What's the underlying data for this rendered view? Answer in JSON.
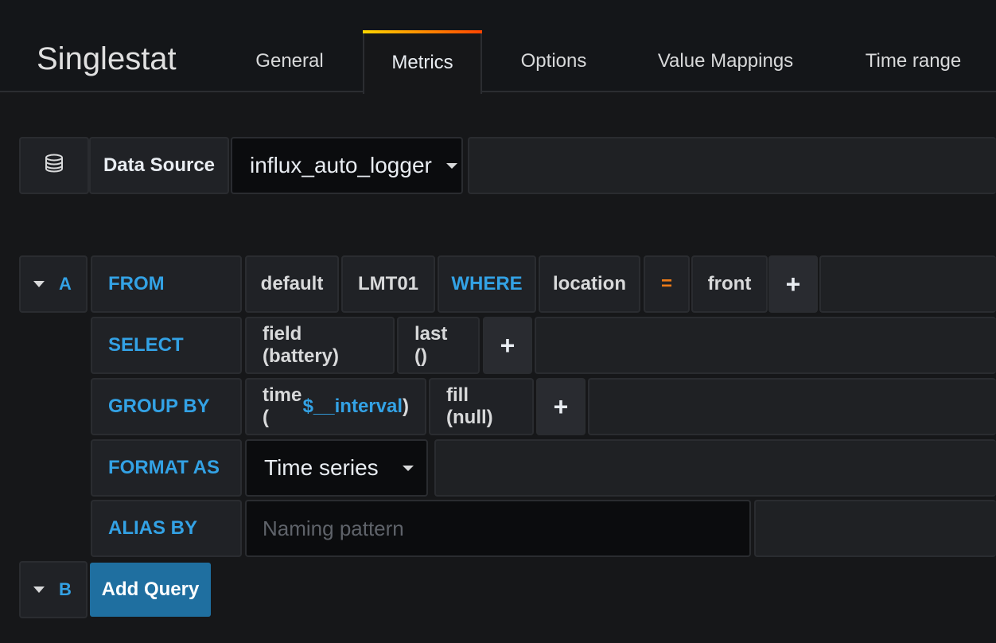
{
  "panel": {
    "title": "Singlestat"
  },
  "tabs": [
    {
      "label": "General"
    },
    {
      "label": "Metrics"
    },
    {
      "label": "Options"
    },
    {
      "label": "Value Mappings"
    },
    {
      "label": "Time range"
    }
  ],
  "active_tab": "Metrics",
  "datasource": {
    "label": "Data Source",
    "value": "influx_auto_logger",
    "icon": "database-icon"
  },
  "query_a": {
    "letter": "A",
    "from": {
      "label": "FROM",
      "retention_policy": "default",
      "measurement": "LMT01",
      "where_keyword": "WHERE",
      "tag_key": "location",
      "operator": "=",
      "tag_value": "front",
      "add": "+"
    },
    "select": {
      "label": "SELECT",
      "field": "field (battery)",
      "func": "last ()",
      "add": "+"
    },
    "group_by": {
      "label": "GROUP BY",
      "time_prefix": "time (",
      "time_var": "$__interval",
      "time_suffix": ")",
      "fill": "fill (null)",
      "add": "+"
    },
    "format_as": {
      "label": "FORMAT AS",
      "value": "Time series"
    },
    "alias_by": {
      "label": "ALIAS BY",
      "placeholder": "Naming pattern",
      "value": ""
    }
  },
  "query_b": {
    "letter": "B",
    "add_query_label": "Add Query"
  },
  "colors": {
    "accent_blue": "#33a2e5",
    "operator_orange": "#eb7b18",
    "button_blue": "#1f6fa0"
  }
}
